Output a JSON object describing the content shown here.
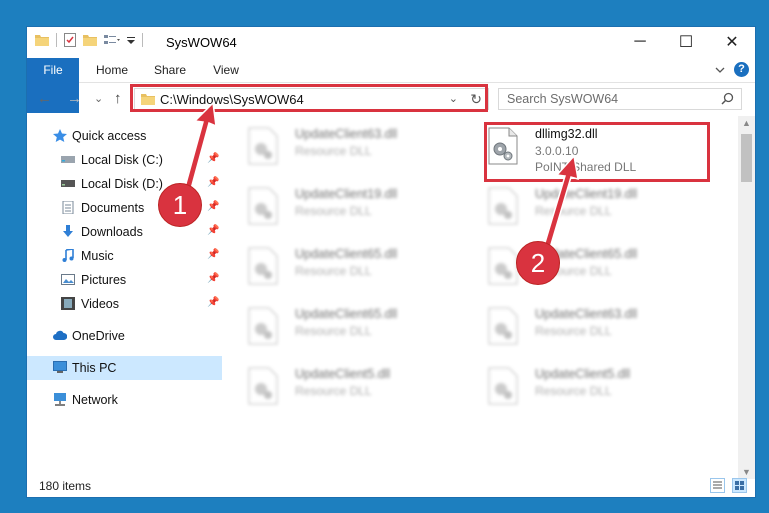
{
  "window": {
    "title": "SysWOW64",
    "minimize": "─",
    "maximize": "☐",
    "close": "✕"
  },
  "ribbon": {
    "tabs": [
      "File",
      "Home",
      "Share",
      "View"
    ],
    "help": "?"
  },
  "address": {
    "path": "C:\\Windows\\SysWOW64",
    "dropdown": "⌄",
    "refresh": "↻"
  },
  "search": {
    "placeholder": "Search SysWOW64"
  },
  "nav": {
    "back": "←",
    "forward": "→",
    "recent": "⌄",
    "up": "↑",
    "items": [
      {
        "label": "Quick access",
        "icon": "star-icon",
        "pinned": false
      },
      {
        "label": "Local Disk (C:)",
        "icon": "drive-icon",
        "pinned": true
      },
      {
        "label": "Local Disk (D:)",
        "icon": "drive-icon",
        "pinned": true
      },
      {
        "label": "Documents",
        "icon": "documents-icon",
        "pinned": true
      },
      {
        "label": "Downloads",
        "icon": "download-icon",
        "pinned": true
      },
      {
        "label": "Music",
        "icon": "music-icon",
        "pinned": true
      },
      {
        "label": "Pictures",
        "icon": "pictures-icon",
        "pinned": true
      },
      {
        "label": "Videos",
        "icon": "videos-icon",
        "pinned": true
      },
      {
        "label": "OneDrive",
        "icon": "cloud-icon",
        "pinned": false
      },
      {
        "label": "This PC",
        "icon": "pc-icon",
        "pinned": false
      },
      {
        "label": "Network",
        "icon": "network-icon",
        "pinned": false
      }
    ]
  },
  "files": {
    "highlighted": {
      "name": "dllimg32.dll",
      "version": "3.0.0.10",
      "description": "PoINT Shared DLL"
    },
    "left_column": [
      {
        "name": "UpdateClient63.dll",
        "description": "Resource DLL"
      },
      {
        "name": "UpdateClient19.dll",
        "description": "Resource DLL"
      },
      {
        "name": "UpdateClient65.dll",
        "description": "Resource DLL"
      },
      {
        "name": "UpdateClient65.dll",
        "description": "Resource DLL"
      },
      {
        "name": "UpdateClient5.dll",
        "description": "Resource DLL"
      }
    ],
    "right_column": [
      {
        "name": "UpdateClient19.dll",
        "description": "Resource DLL"
      },
      {
        "name": "UpdateClient65.dll",
        "description": "Resource DLL"
      },
      {
        "name": "UpdateClient63.dll",
        "description": "Resource DLL"
      },
      {
        "name": "UpdateClient5.dll",
        "description": "Resource DLL"
      }
    ]
  },
  "status": {
    "item_count": "180 items"
  },
  "annotations": {
    "step1": "1",
    "step2": "2",
    "color": "#d9333f"
  }
}
